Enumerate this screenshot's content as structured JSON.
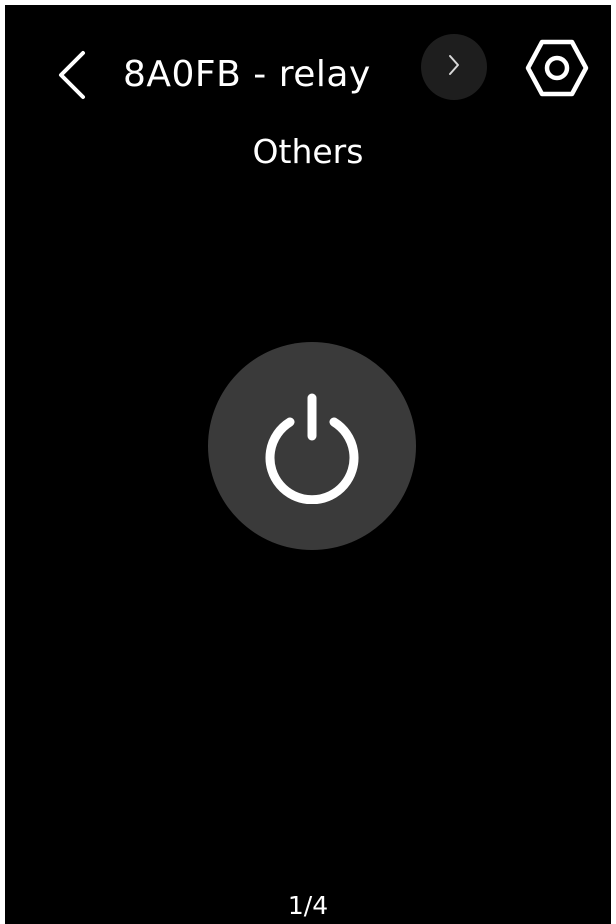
{
  "header": {
    "title": "8A0FB - relay",
    "back_icon": "chevron-left-icon",
    "next_icon": "chevron-right-icon",
    "settings_icon": "hexagon-gear-icon"
  },
  "subtitle": "Others",
  "control": {
    "icon": "power-icon"
  },
  "pager": {
    "label": "1/4"
  },
  "colors": {
    "background": "#000000",
    "text": "#ffffff",
    "power_button": "#3a3a3a",
    "next_button": "#1e1e1e"
  }
}
